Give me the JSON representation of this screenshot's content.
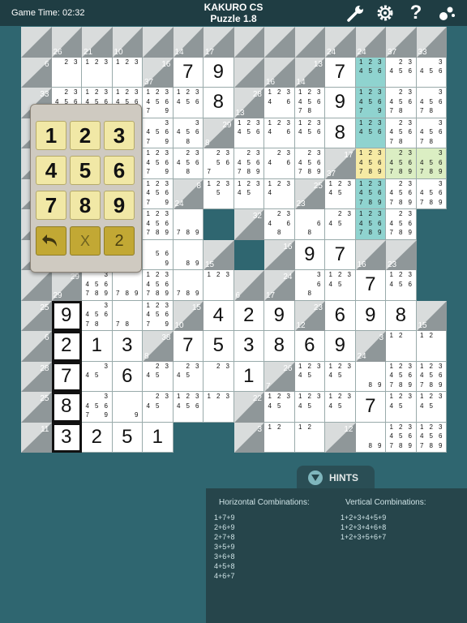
{
  "header": {
    "game_time": "Game Time: 02:32",
    "app_title": "KAKURO CS",
    "puzzle_label": "Puzzle 1.8"
  },
  "icons": {
    "tools": "wrench-icon",
    "settings": "gear-icon",
    "help": "question-icon",
    "hints": "bubbles-icon"
  },
  "colors": {
    "highlight": "#8fd3cf",
    "selected_yellow": "#f6eaa4",
    "selected_green": "#dbeec3",
    "key_face": "#f1e8a6"
  },
  "keypad": {
    "keys": [
      "1",
      "2",
      "3",
      "4",
      "5",
      "6",
      "7",
      "8",
      "9"
    ],
    "undo": "undo",
    "clear": "X",
    "pencil": "2"
  },
  "hints": {
    "label": "HINTS",
    "horizontal_title": "Horizontal Combinations:",
    "horizontal": [
      "1+7+9",
      "2+6+9",
      "2+7+8",
      "3+5+9",
      "3+6+8",
      "4+5+8",
      "4+6+7"
    ],
    "vertical_title": "Vertical Combinations:",
    "vertical": [
      "1+2+3+4+5+9",
      "1+2+3+4+6+8",
      "1+2+3+5+6+7"
    ]
  },
  "grid": {
    "cells": [
      {
        "r": 0,
        "c": 0,
        "t": "c",
        "v": "",
        "h": ""
      },
      {
        "r": 0,
        "c": 1,
        "t": "c",
        "v": "26",
        "h": ""
      },
      {
        "r": 0,
        "c": 2,
        "t": "c",
        "v": "21",
        "h": ""
      },
      {
        "r": 0,
        "c": 3,
        "t": "c",
        "v": "10",
        "h": ""
      },
      {
        "r": 0,
        "c": 4,
        "t": "c",
        "v": "",
        "h": ""
      },
      {
        "r": 0,
        "c": 5,
        "t": "c",
        "v": "14",
        "h": ""
      },
      {
        "r": 0,
        "c": 6,
        "t": "c",
        "v": "17",
        "h": ""
      },
      {
        "r": 0,
        "c": 7,
        "t": "c",
        "v": "",
        "h": ""
      },
      {
        "r": 0,
        "c": 8,
        "t": "c",
        "v": "",
        "h": ""
      },
      {
        "r": 0,
        "c": 9,
        "t": "c",
        "v": "",
        "h": ""
      },
      {
        "r": 0,
        "c": 10,
        "t": "c",
        "v": "24",
        "h": ""
      },
      {
        "r": 0,
        "c": 11,
        "t": "c",
        "v": "24",
        "h": ""
      },
      {
        "r": 0,
        "c": 12,
        "t": "c",
        "v": "37",
        "h": ""
      },
      {
        "r": 0,
        "c": 13,
        "t": "c",
        "v": "33",
        "h": ""
      },
      {
        "r": 1,
        "c": 0,
        "t": "c",
        "v": "",
        "h": "6"
      },
      {
        "r": 1,
        "c": 1,
        "t": "w",
        "n": "23"
      },
      {
        "r": 1,
        "c": 2,
        "t": "w",
        "n": "123"
      },
      {
        "r": 1,
        "c": 3,
        "t": "w",
        "n": "123"
      },
      {
        "r": 1,
        "c": 4,
        "t": "c",
        "v": "37",
        "h": "16"
      },
      {
        "r": 1,
        "c": 5,
        "t": "w",
        "d": "7"
      },
      {
        "r": 1,
        "c": 6,
        "t": "w",
        "d": "9"
      },
      {
        "r": 1,
        "c": 7,
        "t": "c",
        "v": "",
        "h": ""
      },
      {
        "r": 1,
        "c": 8,
        "t": "c",
        "v": "16",
        "h": ""
      },
      {
        "r": 1,
        "c": 9,
        "t": "c",
        "v": "14",
        "h": "13"
      },
      {
        "r": 1,
        "c": 10,
        "t": "w",
        "d": "7"
      },
      {
        "r": 1,
        "c": 11,
        "t": "w",
        "n": "123456",
        "x": "hl"
      },
      {
        "r": 1,
        "c": 12,
        "t": "w",
        "n": "23456"
      },
      {
        "r": 1,
        "c": 13,
        "t": "w",
        "n": "3456"
      },
      {
        "r": 2,
        "c": 0,
        "t": "c",
        "v": "",
        "h": "33"
      },
      {
        "r": 2,
        "c": 1,
        "t": "w",
        "n": "23456"
      },
      {
        "r": 2,
        "c": 2,
        "t": "w",
        "n": "123456"
      },
      {
        "r": 2,
        "c": 3,
        "t": "w",
        "n": "123456"
      },
      {
        "r": 2,
        "c": 4,
        "t": "w",
        "n": "1234567 9"
      },
      {
        "r": 2,
        "c": 5,
        "t": "w",
        "n": "123456"
      },
      {
        "r": 2,
        "c": 6,
        "t": "w",
        "d": "8"
      },
      {
        "r": 2,
        "c": 7,
        "t": "c",
        "v": "13",
        "h": "28"
      },
      {
        "r": 2,
        "c": 8,
        "t": "w",
        "n": "12346"
      },
      {
        "r": 2,
        "c": 9,
        "t": "w",
        "n": "123456 78"
      },
      {
        "r": 2,
        "c": 10,
        "t": "w",
        "d": "9"
      },
      {
        "r": 2,
        "c": 11,
        "t": "w",
        "n": "1234567 9",
        "x": "hl"
      },
      {
        "r": 2,
        "c": 12,
        "t": "w",
        "n": "23456 78"
      },
      {
        "r": 2,
        "c": 13,
        "t": "w",
        "n": "3456 78"
      },
      {
        "r": 3,
        "c": 0,
        "t": "c",
        "v": "",
        "h": ""
      },
      {
        "r": 3,
        "c": 1,
        "t": "w",
        "n": ""
      },
      {
        "r": 3,
        "c": 2,
        "t": "w",
        "n": ""
      },
      {
        "r": 3,
        "c": 3,
        "t": "w",
        "n": ""
      },
      {
        "r": 3,
        "c": 4,
        "t": "w",
        "n": "3456 79"
      },
      {
        "r": 3,
        "c": 5,
        "t": "w",
        "n": "3456 8"
      },
      {
        "r": 3,
        "c": 6,
        "t": "c",
        "v": "8",
        "h": "29"
      },
      {
        "r": 3,
        "c": 7,
        "t": "w",
        "n": "123456"
      },
      {
        "r": 3,
        "c": 8,
        "t": "w",
        "n": "12346"
      },
      {
        "r": 3,
        "c": 9,
        "t": "w",
        "n": "123456"
      },
      {
        "r": 3,
        "c": 10,
        "t": "w",
        "d": "8"
      },
      {
        "r": 3,
        "c": 11,
        "t": "w",
        "n": "123456",
        "x": "hl"
      },
      {
        "r": 3,
        "c": 12,
        "t": "w",
        "n": "23456 78"
      },
      {
        "r": 3,
        "c": 13,
        "t": "w",
        "n": "3456 78"
      },
      {
        "r": 4,
        "c": 0,
        "t": "c",
        "v": "",
        "h": ""
      },
      {
        "r": 4,
        "c": 1,
        "t": "w",
        "n": ""
      },
      {
        "r": 4,
        "c": 2,
        "t": "w",
        "n": ""
      },
      {
        "r": 4,
        "c": 3,
        "t": "w",
        "n": ""
      },
      {
        "r": 4,
        "c": 4,
        "t": "w",
        "n": "123456 79"
      },
      {
        "r": 4,
        "c": 5,
        "t": "w",
        "n": "23456 8"
      },
      {
        "r": 4,
        "c": 6,
        "t": "w",
        "n": "23 567"
      },
      {
        "r": 4,
        "c": 7,
        "t": "w",
        "n": "23456 789"
      },
      {
        "r": 4,
        "c": 8,
        "t": "w",
        "n": "2346"
      },
      {
        "r": 4,
        "c": 9,
        "t": "w",
        "n": "23456 789"
      },
      {
        "r": 4,
        "c": 10,
        "t": "c",
        "v": "37",
        "h": "17"
      },
      {
        "r": 4,
        "c": 11,
        "t": "w",
        "n": "123456789",
        "x": "yl"
      },
      {
        "r": 4,
        "c": 12,
        "t": "w",
        "n": "23456789",
        "x": "gl"
      },
      {
        "r": 4,
        "c": 13,
        "t": "w",
        "n": "3456789",
        "x": "gl"
      },
      {
        "r": 5,
        "c": 0,
        "t": "c",
        "v": "",
        "h": ""
      },
      {
        "r": 5,
        "c": 1,
        "t": "w",
        "n": ""
      },
      {
        "r": 5,
        "c": 2,
        "t": "w",
        "n": ""
      },
      {
        "r": 5,
        "c": 3,
        "t": "w",
        "n": ""
      },
      {
        "r": 5,
        "c": 4,
        "t": "w",
        "n": "123456 79"
      },
      {
        "r": 5,
        "c": 5,
        "t": "c",
        "v": "24",
        "h": "8"
      },
      {
        "r": 5,
        "c": 6,
        "t": "w",
        "n": "1235"
      },
      {
        "r": 5,
        "c": 7,
        "t": "w",
        "n": "12345"
      },
      {
        "r": 5,
        "c": 8,
        "t": "w",
        "n": "1234"
      },
      {
        "r": 5,
        "c": 9,
        "t": "c",
        "v": "23",
        "h": "25"
      },
      {
        "r": 5,
        "c": 10,
        "t": "w",
        "n": "12345"
      },
      {
        "r": 5,
        "c": 11,
        "t": "w",
        "n": "123456789",
        "x": "hl"
      },
      {
        "r": 5,
        "c": 12,
        "t": "w",
        "n": "23456789"
      },
      {
        "r": 5,
        "c": 13,
        "t": "w",
        "n": "3456789"
      },
      {
        "r": 6,
        "c": 0,
        "t": "c",
        "v": "",
        "h": ""
      },
      {
        "r": 6,
        "c": 1,
        "t": "w",
        "n": ""
      },
      {
        "r": 6,
        "c": 2,
        "t": "w",
        "n": ""
      },
      {
        "r": 6,
        "c": 3,
        "t": "w",
        "n": ""
      },
      {
        "r": 6,
        "c": 4,
        "t": "w",
        "n": "123456 789"
      },
      {
        "r": 6,
        "c": 5,
        "t": "w",
        "n": "789"
      },
      {
        "r": 6,
        "c": 6,
        "t": "x"
      },
      {
        "r": 6,
        "c": 7,
        "t": "c",
        "v": "",
        "h": "32"
      },
      {
        "r": 6,
        "c": 8,
        "t": "w",
        "n": "2346 8"
      },
      {
        "r": 6,
        "c": 9,
        "t": "w",
        "n": "68"
      },
      {
        "r": 6,
        "c": 10,
        "t": "w",
        "n": "2345"
      },
      {
        "r": 6,
        "c": 11,
        "t": "w",
        "n": "123456789",
        "x": "hl"
      },
      {
        "r": 6,
        "c": 12,
        "t": "w",
        "n": "23456789"
      },
      {
        "r": 6,
        "c": 13,
        "t": "x"
      },
      {
        "r": 7,
        "c": 0,
        "t": "c",
        "v": "",
        "h": ""
      },
      {
        "r": 7,
        "c": 1,
        "t": "w",
        "n": ""
      },
      {
        "r": 7,
        "c": 2,
        "t": "w",
        "n": ""
      },
      {
        "r": 7,
        "c": 3,
        "t": "w",
        "n": ""
      },
      {
        "r": 7,
        "c": 4,
        "t": "w",
        "n": "56 9"
      },
      {
        "r": 7,
        "c": 5,
        "t": "w",
        "n": "89"
      },
      {
        "r": 7,
        "c": 6,
        "t": "c",
        "v": "15",
        "h": ""
      },
      {
        "r": 7,
        "c": 7,
        "t": "x"
      },
      {
        "r": 7,
        "c": 8,
        "t": "c",
        "v": "",
        "h": "16"
      },
      {
        "r": 7,
        "c": 9,
        "t": "w",
        "d": "9"
      },
      {
        "r": 7,
        "c": 10,
        "t": "w",
        "d": "7"
      },
      {
        "r": 7,
        "c": 11,
        "t": "c",
        "v": "16",
        "h": ""
      },
      {
        "r": 7,
        "c": 12,
        "t": "c",
        "v": "23",
        "h": ""
      },
      {
        "r": 7,
        "c": 13,
        "t": "x"
      },
      {
        "r": 8,
        "c": 0,
        "t": "c",
        "v": "",
        "h": ""
      },
      {
        "r": 8,
        "c": 1,
        "t": "c",
        "v": "29",
        "h": "29"
      },
      {
        "r": 8,
        "c": 2,
        "t": "w",
        "n": "3456 789"
      },
      {
        "r": 8,
        "c": 3,
        "t": "w",
        "n": "789"
      },
      {
        "r": 8,
        "c": 4,
        "t": "w",
        "n": "123456 789"
      },
      {
        "r": 8,
        "c": 5,
        "t": "w",
        "n": "789"
      },
      {
        "r": 8,
        "c": 6,
        "t": "w",
        "n": "123"
      },
      {
        "r": 8,
        "c": 7,
        "t": "c",
        "v": "6",
        "h": ""
      },
      {
        "r": 8,
        "c": 8,
        "t": "c",
        "v": "17",
        "h": "24"
      },
      {
        "r": 8,
        "c": 9,
        "t": "w",
        "n": "368"
      },
      {
        "r": 8,
        "c": 10,
        "t": "w",
        "n": "12345"
      },
      {
        "r": 8,
        "c": 11,
        "t": "w",
        "d": "7"
      },
      {
        "r": 8,
        "c": 12,
        "t": "w",
        "n": "123456"
      },
      {
        "r": 8,
        "c": 13,
        "t": "x"
      },
      {
        "r": 9,
        "c": 0,
        "t": "c",
        "v": "",
        "h": "25"
      },
      {
        "r": 9,
        "c": 1,
        "t": "w",
        "d": "9",
        "x": "sel"
      },
      {
        "r": 9,
        "c": 2,
        "t": "w",
        "n": "3456 78"
      },
      {
        "r": 9,
        "c": 3,
        "t": "w",
        "n": "78"
      },
      {
        "r": 9,
        "c": 4,
        "t": "w",
        "n": "123456 79"
      },
      {
        "r": 9,
        "c": 5,
        "t": "c",
        "v": "10",
        "h": "15"
      },
      {
        "r": 9,
        "c": 6,
        "t": "w",
        "d": "4"
      },
      {
        "r": 9,
        "c": 7,
        "t": "w",
        "d": "2"
      },
      {
        "r": 9,
        "c": 8,
        "t": "w",
        "d": "9"
      },
      {
        "r": 9,
        "c": 9,
        "t": "c",
        "v": "12",
        "h": "23"
      },
      {
        "r": 9,
        "c": 10,
        "t": "w",
        "d": "6"
      },
      {
        "r": 9,
        "c": 11,
        "t": "w",
        "d": "9"
      },
      {
        "r": 9,
        "c": 12,
        "t": "w",
        "d": "8"
      },
      {
        "r": 9,
        "c": 13,
        "t": "c",
        "v": "15",
        "h": ""
      },
      {
        "r": 10,
        "c": 0,
        "t": "c",
        "v": "",
        "h": "6"
      },
      {
        "r": 10,
        "c": 1,
        "t": "w",
        "d": "2",
        "x": "sel"
      },
      {
        "r": 10,
        "c": 2,
        "t": "w",
        "d": "1"
      },
      {
        "r": 10,
        "c": 3,
        "t": "w",
        "d": "3"
      },
      {
        "r": 10,
        "c": 4,
        "t": "c",
        "v": "8",
        "h": "38"
      },
      {
        "r": 10,
        "c": 5,
        "t": "w",
        "d": "7"
      },
      {
        "r": 10,
        "c": 6,
        "t": "w",
        "d": "5"
      },
      {
        "r": 10,
        "c": 7,
        "t": "w",
        "d": "3"
      },
      {
        "r": 10,
        "c": 8,
        "t": "w",
        "d": "8"
      },
      {
        "r": 10,
        "c": 9,
        "t": "w",
        "d": "6"
      },
      {
        "r": 10,
        "c": 10,
        "t": "w",
        "d": "9"
      },
      {
        "r": 10,
        "c": 11,
        "t": "c",
        "v": "24",
        "h": "3"
      },
      {
        "r": 10,
        "c": 12,
        "t": "w",
        "n": "12"
      },
      {
        "r": 10,
        "c": 13,
        "t": "w",
        "n": "12"
      },
      {
        "r": 11,
        "c": 0,
        "t": "c",
        "v": "",
        "h": "28"
      },
      {
        "r": 11,
        "c": 1,
        "t": "w",
        "d": "7",
        "x": "sel"
      },
      {
        "r": 11,
        "c": 2,
        "t": "w",
        "n": "345"
      },
      {
        "r": 11,
        "c": 3,
        "t": "w",
        "d": "6"
      },
      {
        "r": 11,
        "c": 4,
        "t": "w",
        "n": "2345"
      },
      {
        "r": 11,
        "c": 5,
        "t": "w",
        "n": "2345"
      },
      {
        "r": 11,
        "c": 6,
        "t": "w",
        "n": "23"
      },
      {
        "r": 11,
        "c": 7,
        "t": "w",
        "d": "1"
      },
      {
        "r": 11,
        "c": 8,
        "t": "c",
        "v": "7",
        "h": "26"
      },
      {
        "r": 11,
        "c": 9,
        "t": "w",
        "n": "12345"
      },
      {
        "r": 11,
        "c": 10,
        "t": "w",
        "n": "12345"
      },
      {
        "r": 11,
        "c": 11,
        "t": "w",
        "n": "89"
      },
      {
        "r": 11,
        "c": 12,
        "t": "w",
        "n": "1234567 89"
      },
      {
        "r": 11,
        "c": 13,
        "t": "w",
        "n": "1234567 89"
      },
      {
        "r": 12,
        "c": 0,
        "t": "c",
        "v": "",
        "h": "25"
      },
      {
        "r": 12,
        "c": 1,
        "t": "w",
        "d": "8",
        "x": "sel"
      },
      {
        "r": 12,
        "c": 2,
        "t": "w",
        "n": "3456 79"
      },
      {
        "r": 12,
        "c": 3,
        "t": "w",
        "n": "9"
      },
      {
        "r": 12,
        "c": 4,
        "t": "w",
        "n": "2345"
      },
      {
        "r": 12,
        "c": 5,
        "t": "w",
        "n": "123456"
      },
      {
        "r": 12,
        "c": 6,
        "t": "w",
        "n": "123"
      },
      {
        "r": 12,
        "c": 7,
        "t": "c",
        "v": "",
        "h": "22"
      },
      {
        "r": 12,
        "c": 8,
        "t": "w",
        "n": "12345"
      },
      {
        "r": 12,
        "c": 9,
        "t": "w",
        "n": "12345"
      },
      {
        "r": 12,
        "c": 10,
        "t": "w",
        "n": "12345"
      },
      {
        "r": 12,
        "c": 11,
        "t": "w",
        "d": "7"
      },
      {
        "r": 12,
        "c": 12,
        "t": "w",
        "n": "12345"
      },
      {
        "r": 12,
        "c": 13,
        "t": "w",
        "n": "12345"
      },
      {
        "r": 13,
        "c": 0,
        "t": "c",
        "v": "",
        "h": "11"
      },
      {
        "r": 13,
        "c": 1,
        "t": "w",
        "d": "3",
        "x": "sel"
      },
      {
        "r": 13,
        "c": 2,
        "t": "w",
        "d": "2"
      },
      {
        "r": 13,
        "c": 3,
        "t": "w",
        "d": "5"
      },
      {
        "r": 13,
        "c": 4,
        "t": "w",
        "d": "1"
      },
      {
        "r": 13,
        "c": 5,
        "t": "x"
      },
      {
        "r": 13,
        "c": 6,
        "t": "x"
      },
      {
        "r": 13,
        "c": 7,
        "t": "c",
        "v": "",
        "h": "3"
      },
      {
        "r": 13,
        "c": 8,
        "t": "w",
        "n": "12"
      },
      {
        "r": 13,
        "c": 9,
        "t": "w",
        "n": "12"
      },
      {
        "r": 13,
        "c": 10,
        "t": "c",
        "v": "",
        "h": "12"
      },
      {
        "r": 13,
        "c": 11,
        "t": "w",
        "n": "89"
      },
      {
        "r": 13,
        "c": 12,
        "t": "w",
        "n": "1234567 89"
      },
      {
        "r": 13,
        "c": 13,
        "t": "w",
        "n": "1234567 89"
      }
    ]
  }
}
